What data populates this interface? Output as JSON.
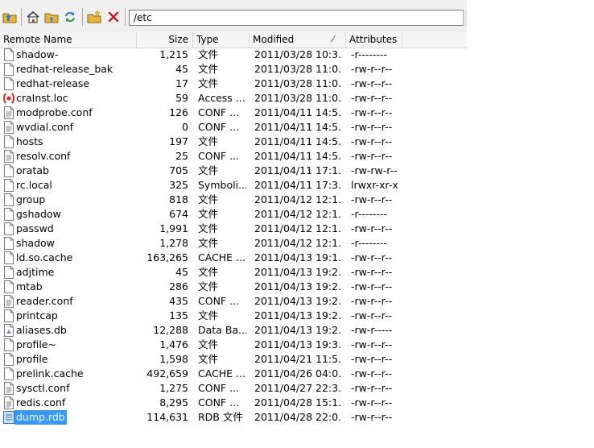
{
  "toolbar": {
    "path": "/etc",
    "icons": [
      "folder-up-icon",
      "home-icon",
      "parent-folder-icon",
      "refresh-icon",
      "new-folder-icon",
      "delete-icon"
    ],
    "colors": {
      "folder": "#e8b53a",
      "delete": "#c81e1e",
      "refresh": "#2a7fd4"
    }
  },
  "columns": {
    "name": "Remote Name",
    "size": "Size",
    "type": "Type",
    "modified": "Modified",
    "attributes": "Attributes"
  },
  "files": [
    {
      "name": "shadow-",
      "size": "1,215",
      "type": "文件",
      "modified": "2011/03/28 10:3...",
      "attributes": "-r--------",
      "icon": "file-icon"
    },
    {
      "name": "redhat-release_bak",
      "size": "45",
      "type": "文件",
      "modified": "2011/03/28 11:0...",
      "attributes": "-rw-r--r--",
      "icon": "file-icon"
    },
    {
      "name": "redhat-release",
      "size": "17",
      "type": "文件",
      "modified": "2011/03/28 11:0...",
      "attributes": "-rw-r--r--",
      "icon": "file-icon"
    },
    {
      "name": "craInst.loc",
      "size": "59",
      "type": "Access ...",
      "modified": "2011/03/28 11:0...",
      "attributes": "-rw-r--r--",
      "icon": "access-file-icon"
    },
    {
      "name": "modprobe.conf",
      "size": "126",
      "type": "CONF ...",
      "modified": "2011/04/11 14:5...",
      "attributes": "-rw-r--r--",
      "icon": "conf-file-icon"
    },
    {
      "name": "wvdial.conf",
      "size": "0",
      "type": "CONF ...",
      "modified": "2011/04/11 14:5...",
      "attributes": "-rw-r--r--",
      "icon": "conf-file-icon"
    },
    {
      "name": "hosts",
      "size": "197",
      "type": "文件",
      "modified": "2011/04/11 14:5...",
      "attributes": "-rw-r--r--",
      "icon": "file-icon"
    },
    {
      "name": "resolv.conf",
      "size": "25",
      "type": "CONF ...",
      "modified": "2011/04/11 14:5...",
      "attributes": "-rw-r--r--",
      "icon": "conf-file-icon"
    },
    {
      "name": "oratab",
      "size": "705",
      "type": "文件",
      "modified": "2011/04/11 17:1...",
      "attributes": "-rw-rw-r--",
      "icon": "file-icon"
    },
    {
      "name": "rc.local",
      "size": "325",
      "type": "Symboli...",
      "modified": "2011/04/11 17:3...",
      "attributes": "lrwxr-xr-x",
      "icon": "file-icon"
    },
    {
      "name": "group",
      "size": "818",
      "type": "文件",
      "modified": "2011/04/12 12:1...",
      "attributes": "-rw-r--r--",
      "icon": "file-icon"
    },
    {
      "name": "gshadow",
      "size": "674",
      "type": "文件",
      "modified": "2011/04/12 12:1...",
      "attributes": "-r--------",
      "icon": "file-icon"
    },
    {
      "name": "passwd",
      "size": "1,991",
      "type": "文件",
      "modified": "2011/04/12 12:1...",
      "attributes": "-rw-r--r--",
      "icon": "file-icon"
    },
    {
      "name": "shadow",
      "size": "1,278",
      "type": "文件",
      "modified": "2011/04/12 12:1...",
      "attributes": "-r--------",
      "icon": "file-icon"
    },
    {
      "name": "ld.so.cache",
      "size": "163,265",
      "type": "CACHE ...",
      "modified": "2011/04/13 19:1...",
      "attributes": "-rw-r--r--",
      "icon": "file-icon"
    },
    {
      "name": "adjtime",
      "size": "45",
      "type": "文件",
      "modified": "2011/04/13 19:2...",
      "attributes": "-rw-r--r--",
      "icon": "file-icon"
    },
    {
      "name": "mtab",
      "size": "286",
      "type": "文件",
      "modified": "2011/04/13 19:2...",
      "attributes": "-rw-r--r--",
      "icon": "file-icon"
    },
    {
      "name": "reader.conf",
      "size": "435",
      "type": "CONF ...",
      "modified": "2011/04/13 19:2...",
      "attributes": "-rw-r--r--",
      "icon": "conf-file-icon"
    },
    {
      "name": "printcap",
      "size": "135",
      "type": "文件",
      "modified": "2011/04/13 19:2...",
      "attributes": "-rw-r--r--",
      "icon": "file-icon"
    },
    {
      "name": "aliases.db",
      "size": "12,288",
      "type": "Data Ba...",
      "modified": "2011/04/13 19:2...",
      "attributes": "-rw-r-----",
      "icon": "database-file-icon"
    },
    {
      "name": "profile~",
      "size": "1,476",
      "type": "文件",
      "modified": "2011/04/13 19:3...",
      "attributes": "-rw-r--r--",
      "icon": "file-icon"
    },
    {
      "name": "profile",
      "size": "1,598",
      "type": "文件",
      "modified": "2011/04/21 11:5...",
      "attributes": "-rw-r--r--",
      "icon": "file-icon"
    },
    {
      "name": "prelink.cache",
      "size": "492,659",
      "type": "CACHE ...",
      "modified": "2011/04/26 04:0...",
      "attributes": "-rw-r--r--",
      "icon": "file-icon"
    },
    {
      "name": "sysctl.conf",
      "size": "1,275",
      "type": "CONF ...",
      "modified": "2011/04/27 22:3...",
      "attributes": "-rw-r--r--",
      "icon": "conf-file-icon"
    },
    {
      "name": "redis.conf",
      "size": "8,295",
      "type": "CONF ...",
      "modified": "2011/04/28 15:1...",
      "attributes": "-rw-r--r--",
      "icon": "conf-file-icon"
    },
    {
      "name": "dump.rdb",
      "size": "114,631",
      "type": "RDB 文件",
      "modified": "2011/04/28 22:0...",
      "attributes": "-rw-r--r--",
      "icon": "rdb-file-icon",
      "selected": true
    }
  ]
}
